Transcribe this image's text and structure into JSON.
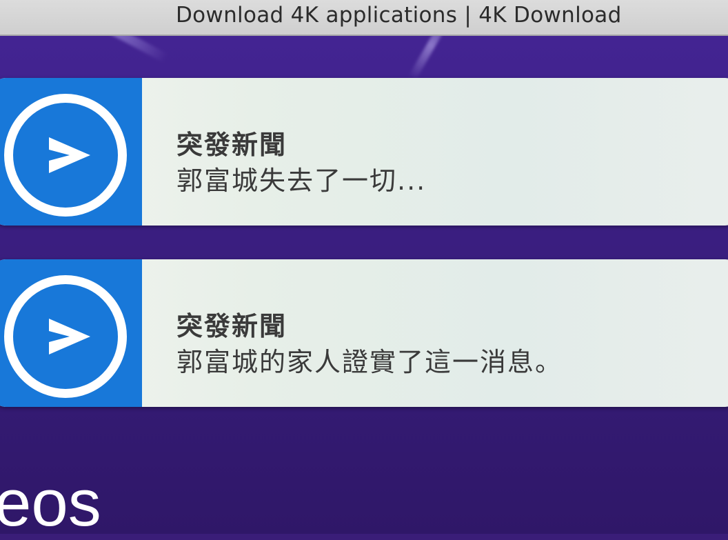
{
  "window": {
    "title": "Download 4K applications | 4K Download"
  },
  "notifications": [
    {
      "app_icon": "vimeo-v-icon",
      "title": "突發新聞",
      "body": "郭富城失去了一切..."
    },
    {
      "app_icon": "vimeo-v-icon",
      "title": "突發新聞",
      "body": "郭富城的家人證實了這一消息。"
    }
  ],
  "page": {
    "text_fragment": "eos"
  },
  "colors": {
    "background": "#3b1f82",
    "icon_panel": "#1878d9",
    "notification_bg": "#e7efe8",
    "title_bar": "#d4d4d4"
  }
}
